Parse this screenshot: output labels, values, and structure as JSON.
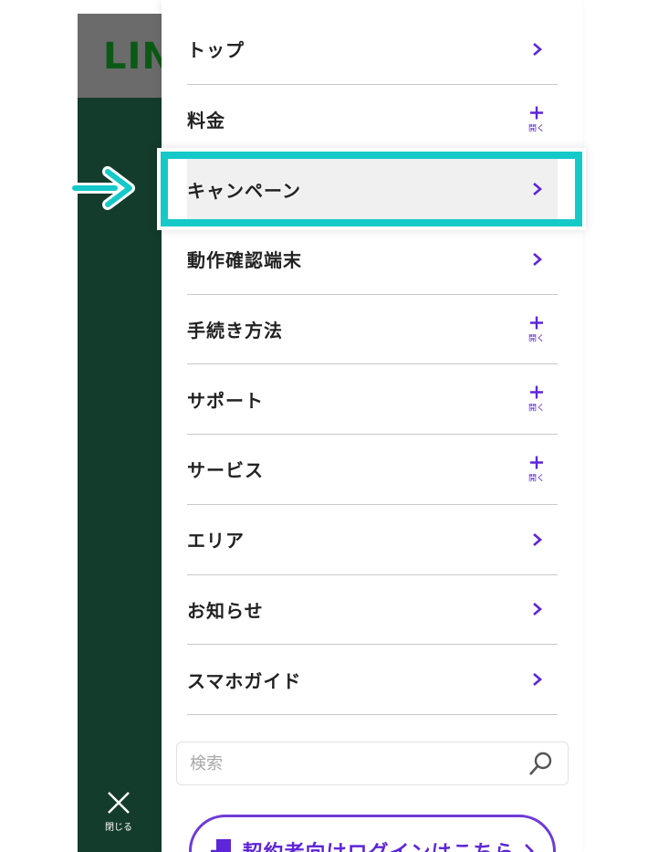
{
  "background": {
    "logo_text": "LIN",
    "close_label": "閉じる"
  },
  "menu": {
    "items": [
      {
        "label": "トップ",
        "indicator": "chevron"
      },
      {
        "label": "料金",
        "indicator": "open"
      },
      {
        "label": "キャンペーン",
        "indicator": "chevron",
        "highlighted": true
      },
      {
        "label": "動作確認端末",
        "indicator": "chevron"
      },
      {
        "label": "手続き方法",
        "indicator": "open"
      },
      {
        "label": "サポート",
        "indicator": "open"
      },
      {
        "label": "サービス",
        "indicator": "open"
      },
      {
        "label": "エリア",
        "indicator": "chevron"
      },
      {
        "label": "お知らせ",
        "indicator": "chevron"
      },
      {
        "label": "スマホガイド",
        "indicator": "chevron"
      }
    ],
    "open_text": "開く"
  },
  "search": {
    "placeholder": "検索"
  },
  "login": {
    "label": "契約者向けログインはこちら"
  },
  "colors": {
    "accent": "#5d26d9",
    "callout": "#16c9c9"
  }
}
